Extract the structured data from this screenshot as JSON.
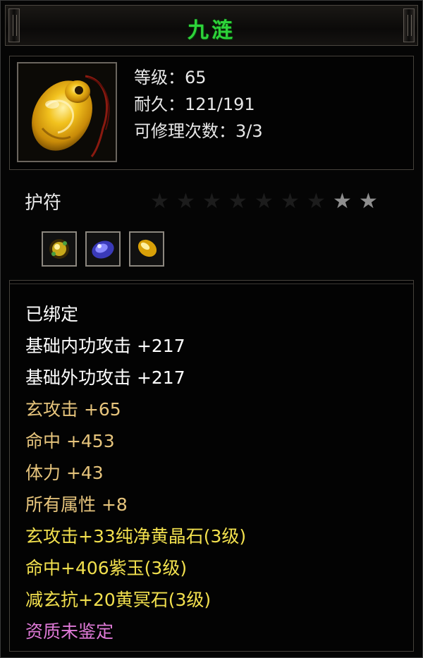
{
  "title": "九涟",
  "header": {
    "level": "等级：65",
    "durability": "耐久：121/191",
    "repair_count": "可修理次数：3/3"
  },
  "item_type": "护符",
  "stars": {
    "total": 9,
    "lit": 2
  },
  "gems": [
    "yellow-crystal-gem-icon",
    "purple-jade-gem-icon",
    "yellow-dark-stone-gem-icon"
  ],
  "attributes": [
    {
      "text": "已绑定",
      "color": "#ffffff"
    },
    {
      "text": "基础内功攻击  +217",
      "color": "#ffffff"
    },
    {
      "text": "基础外功攻击  +217",
      "color": "#ffffff"
    },
    {
      "text": "玄攻击  +65",
      "color": "#e6c47c"
    },
    {
      "text": "命中  +453",
      "color": "#e6c47c"
    },
    {
      "text": "体力  +43",
      "color": "#e6c47c"
    },
    {
      "text": "所有属性  +8",
      "color": "#e6c47c"
    },
    {
      "text": "玄攻击+33纯净黄晶石(3级)",
      "color": "#f2e04e"
    },
    {
      "text": "命中+406紫玉(3级)",
      "color": "#f2e04e"
    },
    {
      "text": "减玄抗+20黄冥石(3级)",
      "color": "#f2e04e"
    },
    {
      "text": "资质未鉴定",
      "color": "#e07ad8"
    }
  ]
}
